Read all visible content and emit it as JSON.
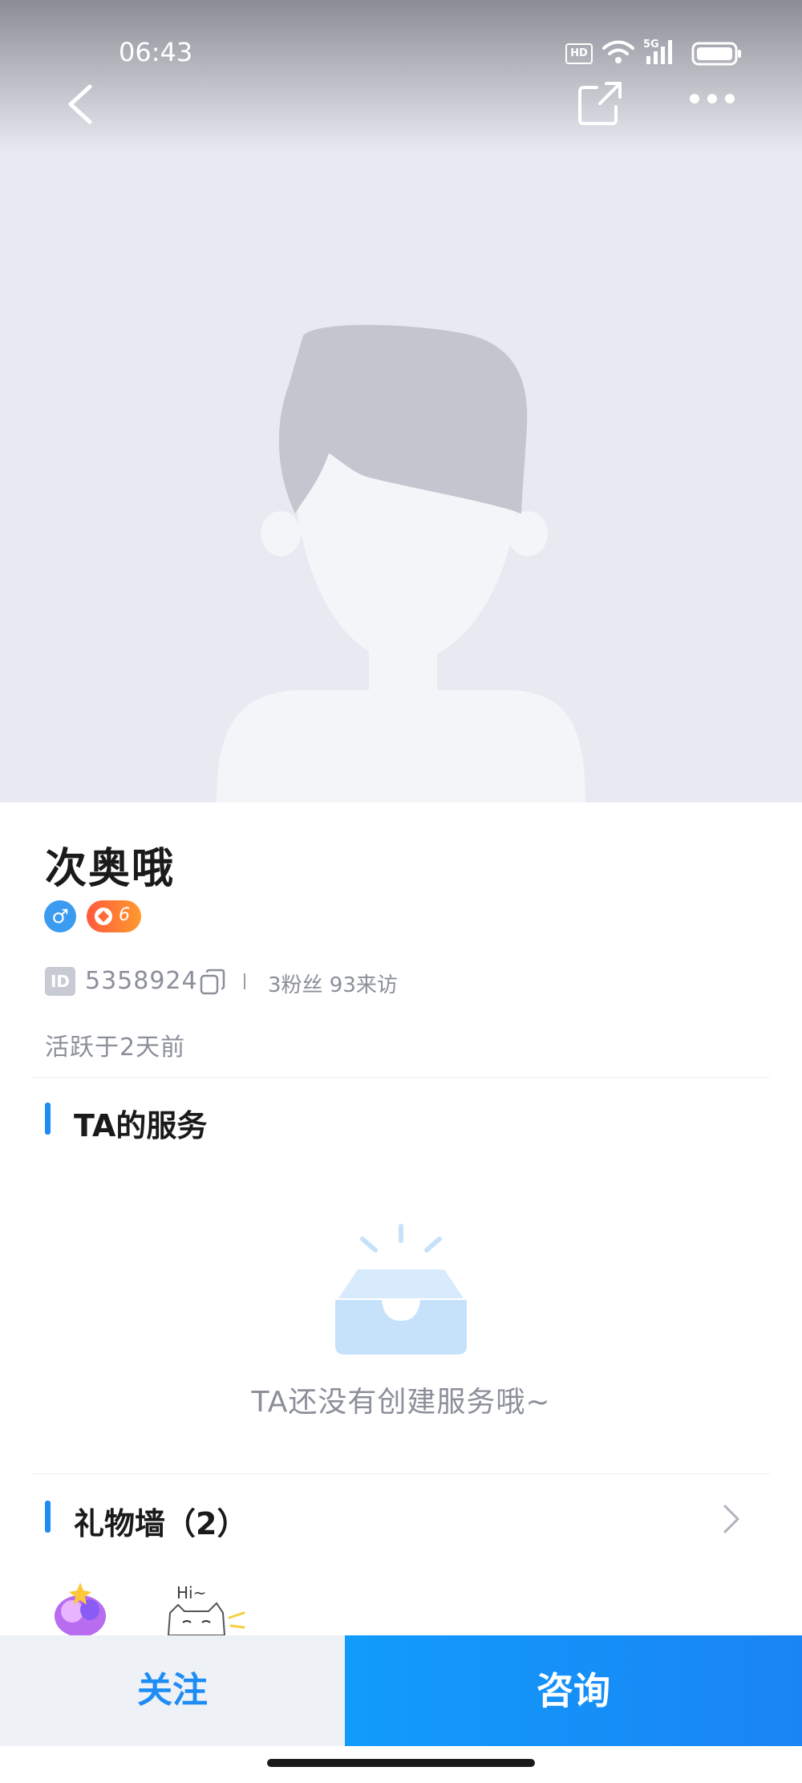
{
  "status_bar": {
    "time": "06:43",
    "hd_label": "HD",
    "network_label": "5G",
    "icons": [
      "hd-icon",
      "wifi-icon",
      "signal-icon",
      "battery-icon"
    ]
  },
  "navbar": {
    "icons": [
      "back-icon",
      "share-icon",
      "more-icon"
    ]
  },
  "profile": {
    "name": "次奥哦",
    "gender_symbol": "♂",
    "level": "6",
    "id_tag": "ID",
    "id_number": "5358924",
    "fans_visits": "3粉丝 93来访",
    "active_status": "活跃于2天前"
  },
  "services": {
    "title": "TA的服务",
    "empty_text": "TA还没有创建服务哦~"
  },
  "gift_wall": {
    "title": "礼物墙（2）",
    "gift2_text": "Hi~"
  },
  "bottom_bar": {
    "follow_label": "关注",
    "consult_label": "咨询"
  },
  "colors": {
    "accent": "#1e8cf5",
    "hero_bg": "#e8eaf2",
    "level_badge": "#ff7a34",
    "gender_badge": "#3a9bf0"
  }
}
